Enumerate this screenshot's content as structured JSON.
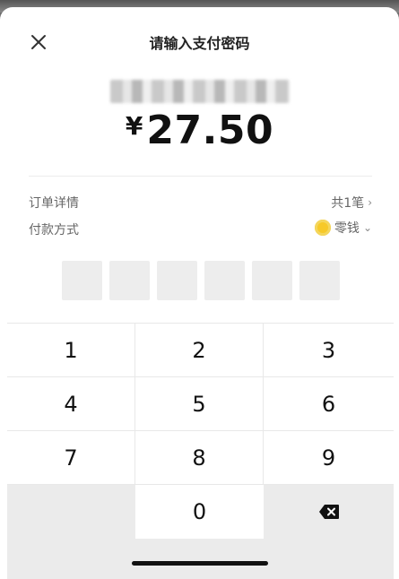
{
  "dialog": {
    "title": "请输入支付密码",
    "currency_symbol": "¥",
    "amount": "27.50"
  },
  "order_details": {
    "label": "订单详情",
    "value": "共1笔",
    "chevron": "›"
  },
  "payment_method": {
    "label": "付款方式",
    "value": "零钱",
    "chevron": "⌄",
    "coin_color": "#f7c928"
  },
  "password": {
    "length": 6,
    "entered": 0
  },
  "keypad": {
    "keys": [
      "1",
      "2",
      "3",
      "4",
      "5",
      "6",
      "7",
      "8",
      "9",
      "",
      "0",
      "backspace"
    ]
  },
  "icons": {
    "close": "close-icon",
    "backspace": "backspace-icon"
  }
}
